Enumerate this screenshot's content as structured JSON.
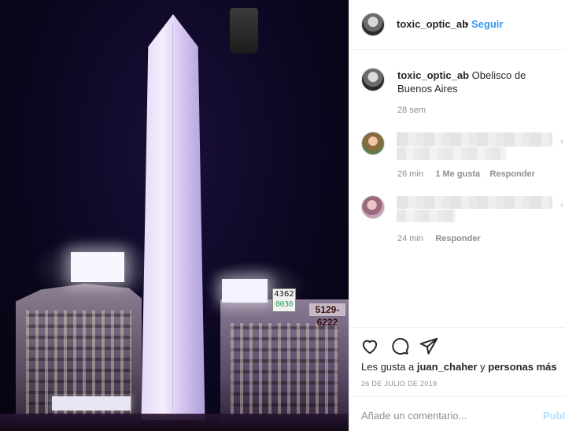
{
  "photo": {
    "scoreboard_top": "4362",
    "scoreboard_bottom": "0030",
    "phone_sign": "5129-6222"
  },
  "header": {
    "username": "toxic_optic_ab",
    "separator": "•",
    "follow_label": "Seguir"
  },
  "caption": {
    "username": "toxic_optic_ab",
    "text": "Obelisco de Buenos Aires",
    "time": "28 sem"
  },
  "comments": [
    {
      "time": "26 min",
      "likes": "1 Me gusta",
      "reply_label": "Responder",
      "blurred": true
    },
    {
      "time": "24 min",
      "reply_label": "Responder",
      "blurred": true
    }
  ],
  "actions": {
    "like_icon": "heart-icon",
    "comment_icon": "comment-icon",
    "share_icon": "send-icon"
  },
  "likes": {
    "prefix": "Les gusta a",
    "user": "juan_chaher",
    "middle": "y",
    "suffix": "personas más"
  },
  "date": "26 DE JULIO DE 2019",
  "comment_box": {
    "placeholder": "Añade un comentario...",
    "publish_label": "Publi"
  },
  "colors": {
    "link_blue": "#3897f0",
    "publish_disabled": "#b2dffc",
    "secondary_text": "#8e8e8e"
  }
}
